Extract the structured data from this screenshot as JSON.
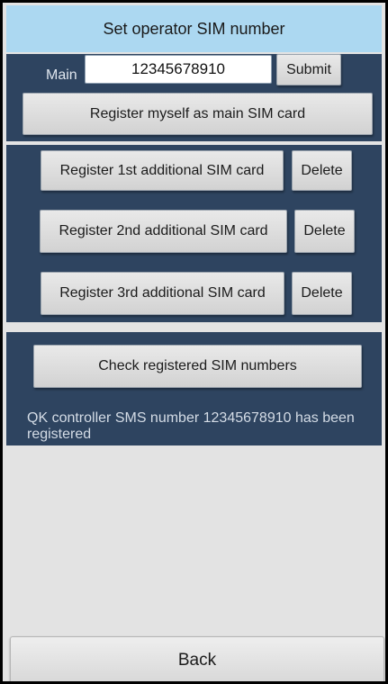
{
  "header": {
    "title": "Set operator SIM number"
  },
  "main_sim": {
    "label": "Main",
    "value": "12345678910",
    "submit_label": "Submit",
    "register_self_label": "Register myself as main SIM card"
  },
  "additional_sims": [
    {
      "register_label": "Register 1st additional SIM card",
      "delete_label": "Delete"
    },
    {
      "register_label": "Register 2nd additional SIM card",
      "delete_label": "Delete"
    },
    {
      "register_label": "Register 3rd additional SIM card",
      "delete_label": "Delete"
    }
  ],
  "check": {
    "button_label": "Check registered SIM numbers",
    "status_message": "QK controller SMS number 12345678910 has been registered"
  },
  "footer": {
    "back_label": "Back"
  },
  "colors": {
    "title_bar": "#acd8f1",
    "panel": "#2e4460",
    "background": "#e3e3e3"
  }
}
